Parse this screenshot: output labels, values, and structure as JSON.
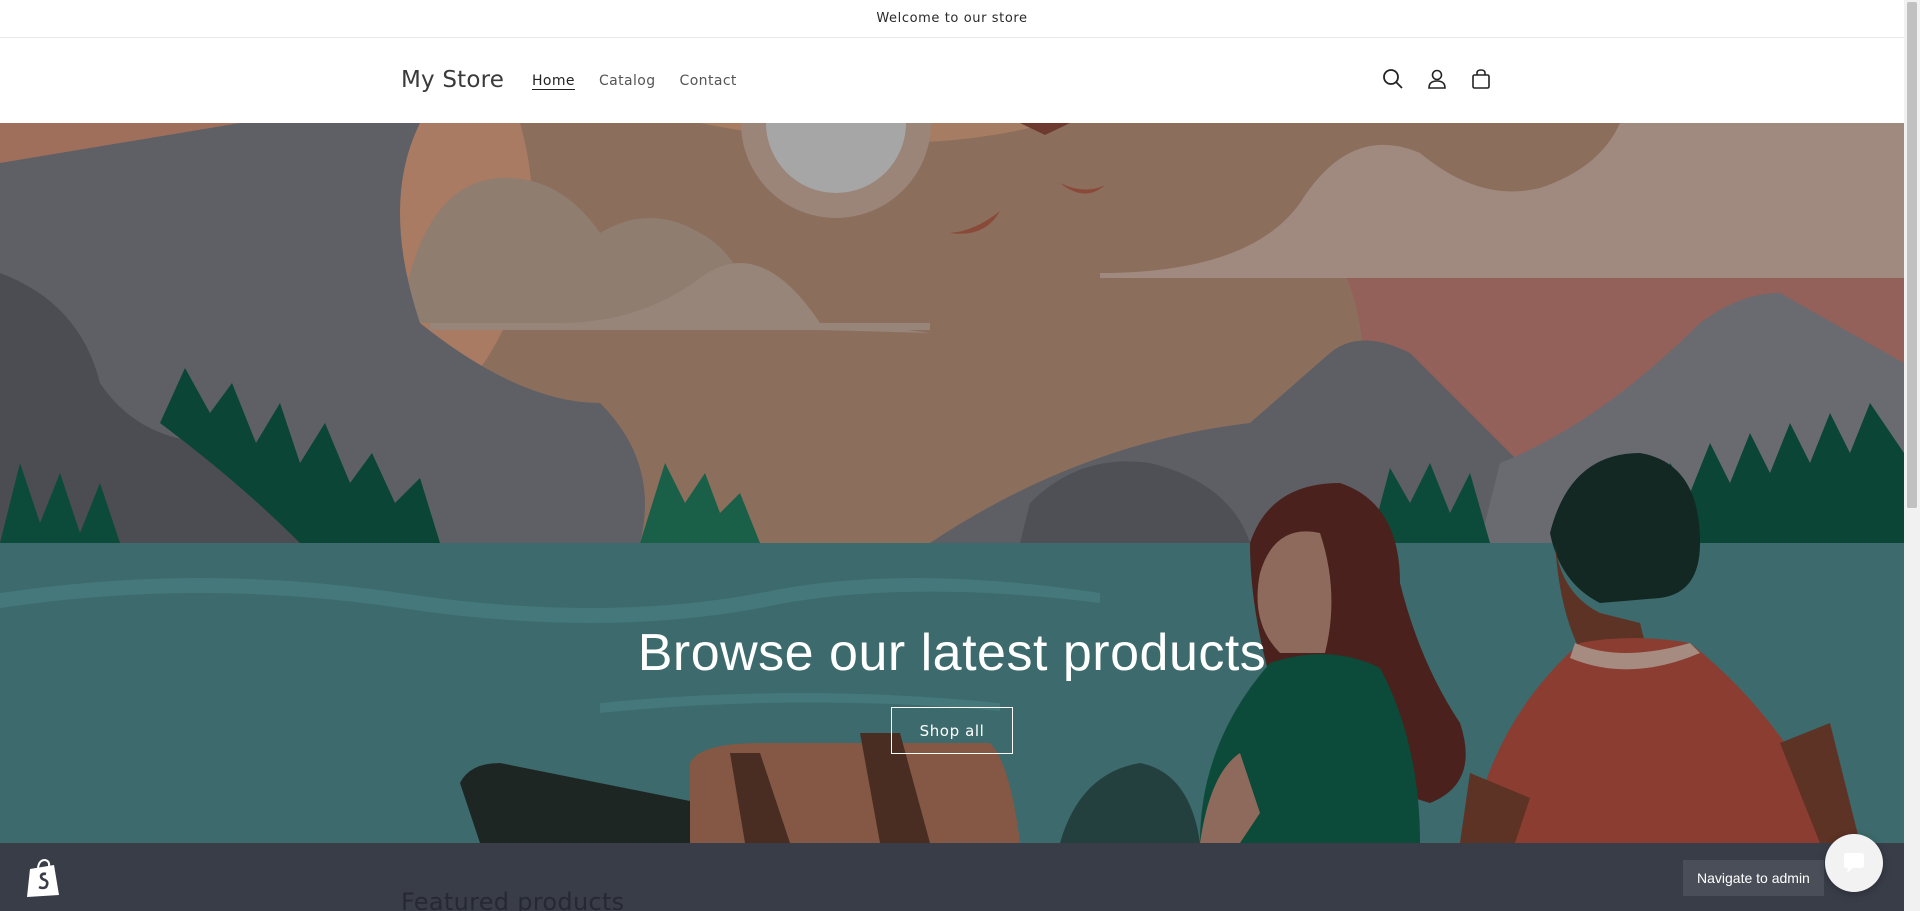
{
  "announcement": {
    "text": "Welcome to our store"
  },
  "header": {
    "logo": "My Store",
    "nav": [
      {
        "label": "Home",
        "active": true
      },
      {
        "label": "Catalog",
        "active": false
      },
      {
        "label": "Contact",
        "active": false
      }
    ],
    "icons": [
      "search-icon",
      "account-icon",
      "cart-icon"
    ]
  },
  "hero": {
    "title": "Browse our latest products",
    "button": "Shop all"
  },
  "featured": {
    "title": "Featured products"
  },
  "admin": {
    "label": "Navigate to admin"
  },
  "colors": {
    "sky": "#8c6e5c",
    "water": "#3d6a6c",
    "trees": "#0c4a3a",
    "mountains": "#5f6066",
    "bottom_bar": "#393d48"
  }
}
